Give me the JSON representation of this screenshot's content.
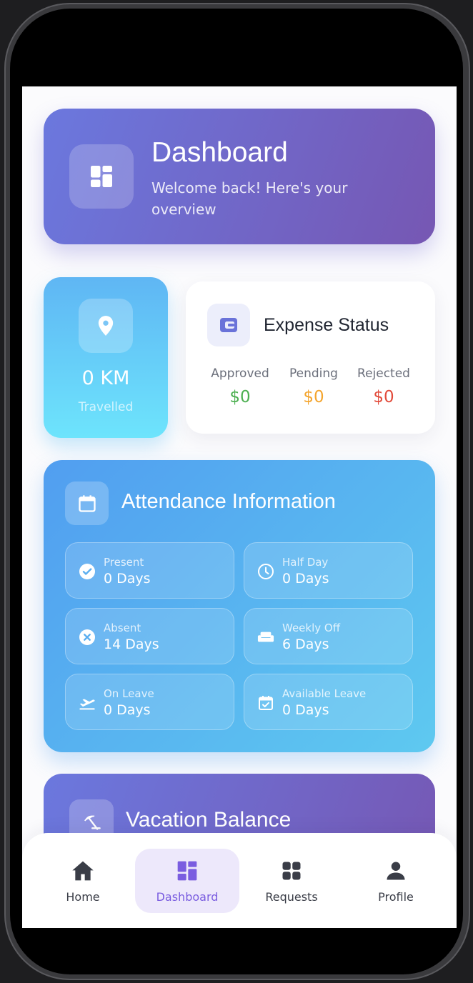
{
  "header": {
    "title": "Dashboard",
    "subtitle": "Welcome back! Here's your overview",
    "icon": "dashboard-icon"
  },
  "distance": {
    "value": "0 KM",
    "label": "Travelled",
    "icon": "location-pin-icon"
  },
  "expense": {
    "title": "Expense Status",
    "icon": "wallet-icon",
    "items": [
      {
        "label": "Approved",
        "value": "$0",
        "color": "#4caf50"
      },
      {
        "label": "Pending",
        "value": "$0",
        "color": "#f4a52e"
      },
      {
        "label": "Rejected",
        "value": "$0",
        "color": "#e24b3b"
      }
    ]
  },
  "attendance": {
    "title": "Attendance Information",
    "icon": "calendar-icon",
    "tiles": [
      {
        "label": "Present",
        "value": "0 Days",
        "icon": "check-circle-icon"
      },
      {
        "label": "Half Day",
        "value": "0 Days",
        "icon": "clock-icon"
      },
      {
        "label": "Absent",
        "value": "14 Days",
        "icon": "cancel-circle-icon"
      },
      {
        "label": "Weekly Off",
        "value": "6 Days",
        "icon": "sofa-icon"
      },
      {
        "label": "On Leave",
        "value": "0 Days",
        "icon": "flight-takeoff-icon"
      },
      {
        "label": "Available Leave",
        "value": "0 Days",
        "icon": "calendar-check-icon"
      }
    ]
  },
  "vacation": {
    "title": "Vacation Balance",
    "icon": "beach-umbrella-icon"
  },
  "nav": {
    "items": [
      {
        "label": "Home",
        "icon": "home-icon",
        "active": false
      },
      {
        "label": "Dashboard",
        "icon": "dashboard-icon",
        "active": true
      },
      {
        "label": "Requests",
        "icon": "grid-icon",
        "active": false
      },
      {
        "label": "Profile",
        "icon": "person-icon",
        "active": false
      }
    ],
    "active_color": "#7a5de0",
    "inactive_color": "#3a3d47"
  }
}
